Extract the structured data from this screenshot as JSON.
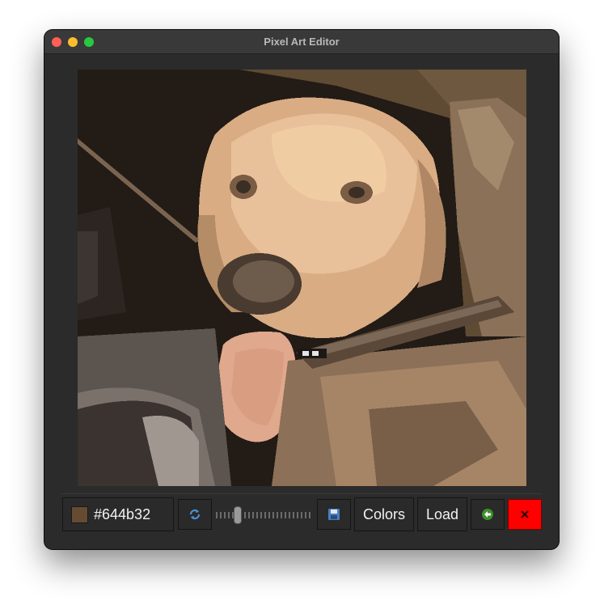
{
  "window": {
    "title": "Pixel Art Editor"
  },
  "toolbar": {
    "color_hex": "#644b32",
    "colors_label": "Colors",
    "load_label": "Load",
    "slider_value": 0.2
  },
  "icons": {
    "refresh": "refresh-icon",
    "save": "floppy-disk-icon",
    "back": "arrow-left-icon",
    "quit": "x-icon"
  },
  "palette": {
    "current": "#644b32",
    "quit_bg": "#ff0000",
    "refresh_accent": "#4a90d9",
    "back_accent": "#5bbf3a"
  }
}
